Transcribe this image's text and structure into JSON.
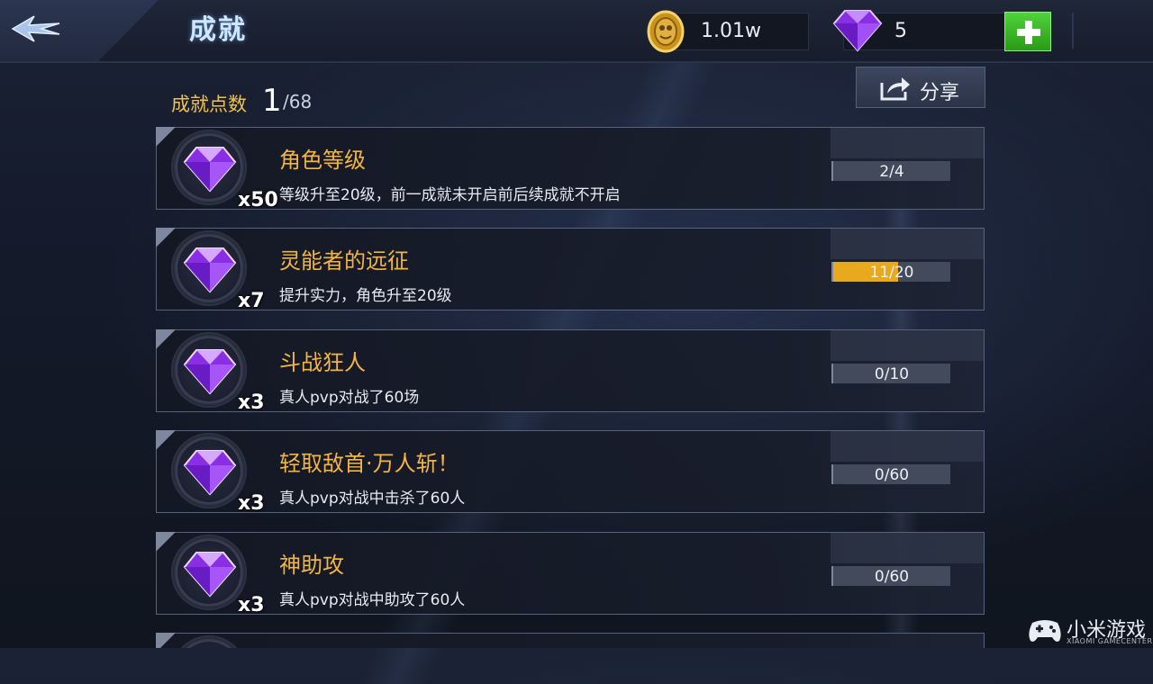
{
  "header": {
    "title": "成就",
    "gold_value": "1.01w",
    "gem_value": "5"
  },
  "summary": {
    "points_label": "成就点数",
    "points_value": "1",
    "points_total": "/68",
    "share_label": "分享"
  },
  "achievements": [
    {
      "title": "角色等级",
      "desc": "等级升至20级，前一成就未开启前后续成就不开启",
      "reward": "x50",
      "progress": "2/4",
      "progress_fraction": 0
    },
    {
      "title": "灵能者的远征",
      "desc": "提升实力，角色升至20级",
      "reward": "x7",
      "progress": "11/20",
      "progress_fraction": 0.55
    },
    {
      "title": "斗战狂人",
      "desc": "真人pvp对战了60场",
      "reward": "x3",
      "progress": "0/10",
      "progress_fraction": 0
    },
    {
      "title": "轻取敌首·万人斩！",
      "desc": "真人pvp对战中击杀了60人",
      "reward": "x3",
      "progress": "0/60",
      "progress_fraction": 0
    },
    {
      "title": "神助攻",
      "desc": "真人pvp对战中助攻了60人",
      "reward": "x3",
      "progress": "0/60",
      "progress_fraction": 0
    }
  ],
  "watermark": {
    "text": "小米游戏",
    "subtext": "XIAOMI GAMECENTER"
  },
  "colors": {
    "accent_gold": "#f2b445",
    "progress_fill": "#e8a91c",
    "plus_green": "#3cbf28",
    "gem_purple": "#9b3ff0"
  },
  "icons": [
    "back-arrow-icon",
    "gold-coin-icon",
    "purple-gem-icon",
    "plus-icon",
    "share-icon",
    "gamepad-icon"
  ]
}
